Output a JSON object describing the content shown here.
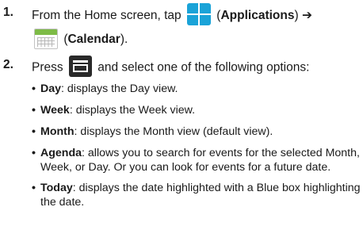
{
  "steps": [
    {
      "num": "1.",
      "before_apps": "From the Home screen, tap",
      "apps_label_open": "(",
      "apps_label": "Applications",
      "apps_label_close": ") ➔",
      "calendar_open": "(",
      "calendar_label": "Calendar",
      "calendar_close": ")."
    },
    {
      "num": "2.",
      "before_icon": "Press",
      "after_icon": "and select one of the following options:"
    }
  ],
  "options": [
    {
      "term": "Day",
      "desc": ": displays the Day view."
    },
    {
      "term": "Week",
      "desc": ": displays the Week view."
    },
    {
      "term": "Month",
      "desc": ": displays the Month view (default view)."
    },
    {
      "term": "Agenda",
      "desc": ": allows you to search for events for the selected Month, Week, or Day. Or you can look for events for a future date."
    },
    {
      "term": "Today",
      "desc": ": displays the date highlighted with a Blue box highlighting the date."
    }
  ],
  "bullet_char": "•",
  "icons": [
    "applications-icon",
    "calendar-icon",
    "menu-icon"
  ]
}
